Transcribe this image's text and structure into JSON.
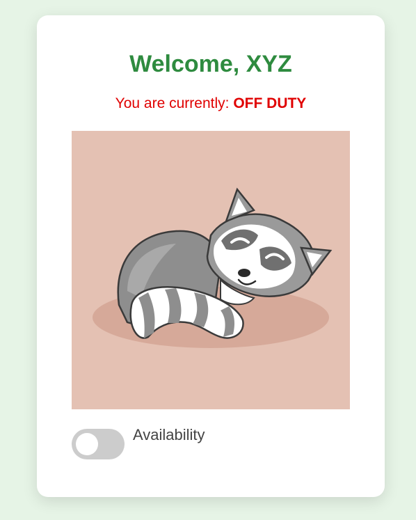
{
  "header": {
    "title": "Welcome, XYZ"
  },
  "status": {
    "prefix": "You are currently:",
    "value": "OFF DUTY"
  },
  "illustration": {
    "icon": "sleeping-raccoon-illustration",
    "background": "#e4c1b3"
  },
  "availability": {
    "label": "Availability",
    "checked": false
  },
  "colors": {
    "title": "#2e8b3f",
    "status": "#e00000",
    "page_background": "#e6f4e6",
    "toggle_off": "#cccccc"
  }
}
